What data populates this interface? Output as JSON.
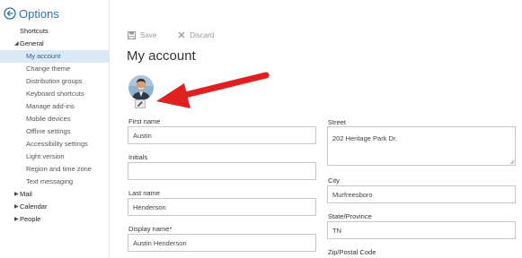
{
  "sidebar": {
    "title": "Options",
    "items": [
      {
        "label": "Shortcuts",
        "level": 0
      },
      {
        "label": "General",
        "level": 0,
        "expanded": true
      },
      {
        "label": "My account",
        "level": 1,
        "selected": true
      },
      {
        "label": "Change theme",
        "level": 1
      },
      {
        "label": "Distribution groups",
        "level": 1
      },
      {
        "label": "Keyboard shortcuts",
        "level": 1
      },
      {
        "label": "Manage add-ins",
        "level": 1
      },
      {
        "label": "Mobile devices",
        "level": 1
      },
      {
        "label": "Offline settings",
        "level": 1
      },
      {
        "label": "Accessibility settings",
        "level": 1
      },
      {
        "label": "Light version",
        "level": 1
      },
      {
        "label": "Region and time zone",
        "level": 1
      },
      {
        "label": "Text messaging",
        "level": 1
      },
      {
        "label": "Mail",
        "level": 0,
        "expanded": false
      },
      {
        "label": "Calendar",
        "level": 0,
        "expanded": false
      },
      {
        "label": "People",
        "level": 0,
        "expanded": false
      }
    ]
  },
  "toolbar": {
    "save_label": "Save",
    "discard_label": "Discard"
  },
  "page": {
    "title": "My account"
  },
  "form": {
    "first_name": {
      "label": "First name",
      "value": "Austin"
    },
    "initials": {
      "label": "Initials",
      "value": ""
    },
    "last_name": {
      "label": "Last name",
      "value": "Henderson"
    },
    "display_name": {
      "label": "Display name",
      "required_mark": "*",
      "value": "Austin Henderson"
    },
    "street": {
      "label": "Street",
      "value": "202 Heritage Park Dr."
    },
    "city": {
      "label": "City",
      "value": "Murfreesboro"
    },
    "state": {
      "label": "State/Province",
      "value": "TN"
    },
    "zip": {
      "label": "Zip/Postal Code"
    }
  },
  "colors": {
    "accent": "#2b72b8",
    "selected_bg": "#dbe8f6",
    "annotation_arrow": "#e02020"
  }
}
